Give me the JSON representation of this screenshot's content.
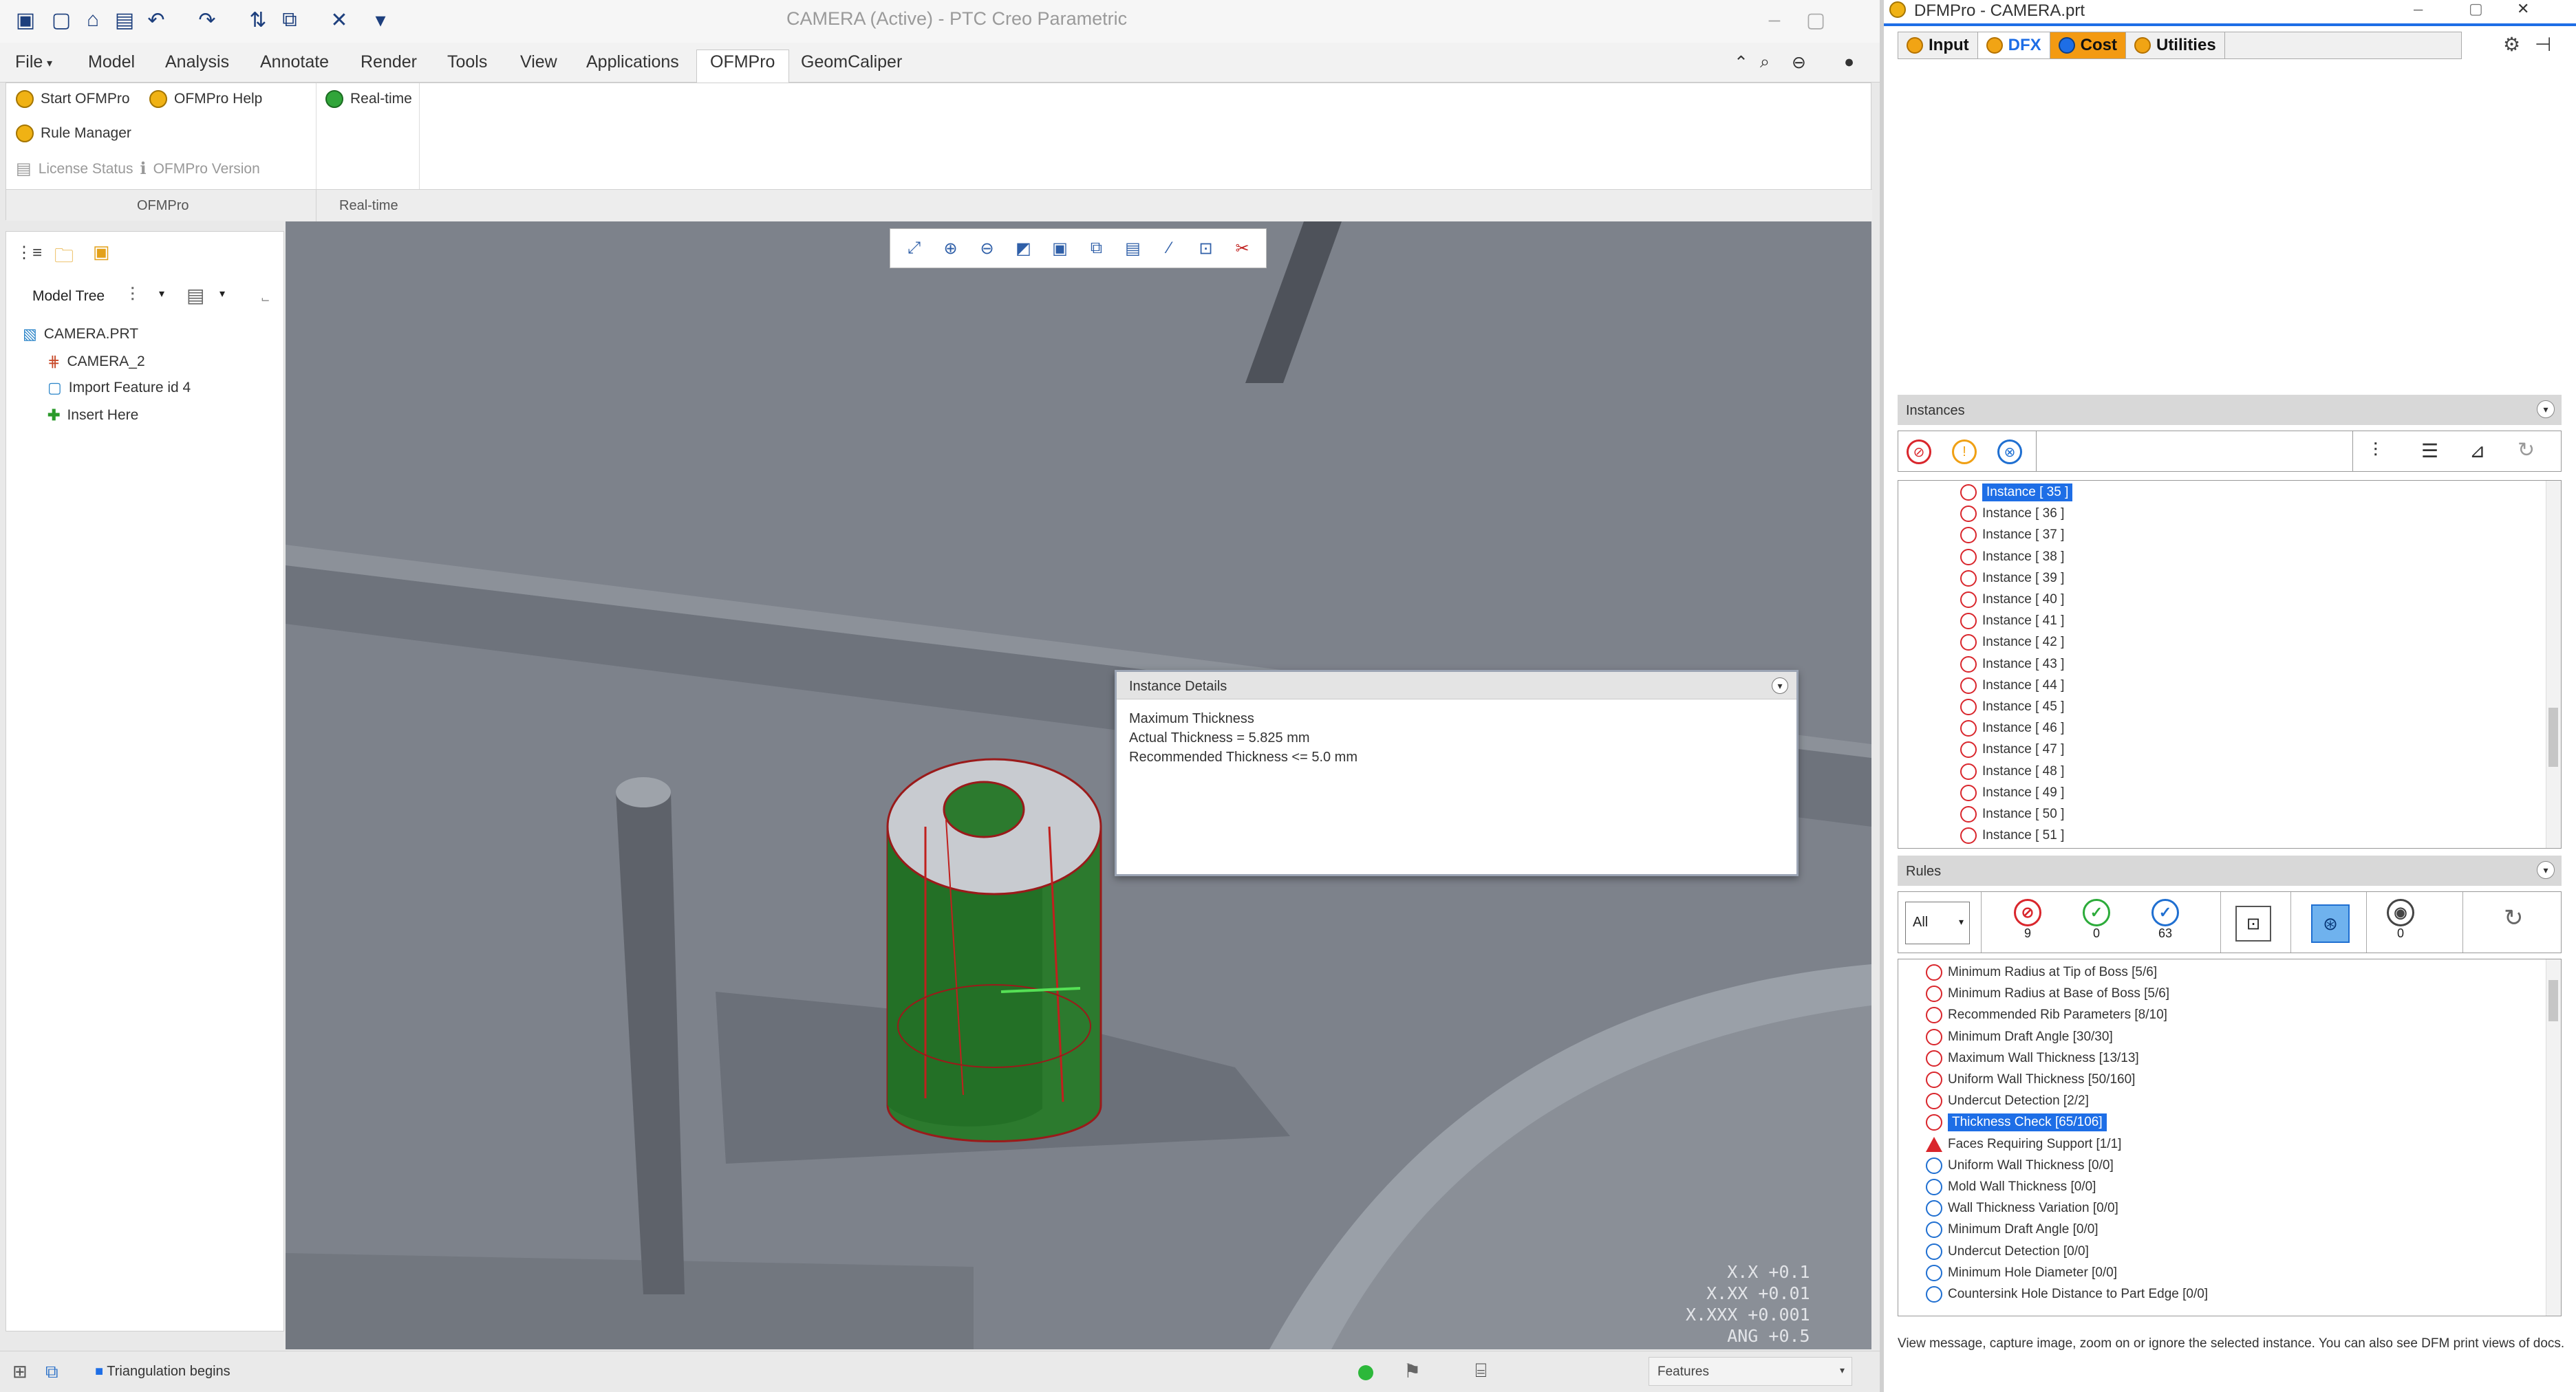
{
  "window": {
    "title": "CAMERA (Active) - PTC Creo Parametric"
  },
  "menu": [
    "File",
    "Model",
    "Analysis",
    "Annotate",
    "Render",
    "Tools",
    "View",
    "Applications",
    "OFMPro",
    "GeomCaliper"
  ],
  "ribbon": {
    "start_ofmpro": "Start OFMPro",
    "ofmpro_help": "OFMPro Help",
    "real_time": "Real-time",
    "rule_manager": "Rule Manager",
    "license_status": "License Status",
    "ofmpro_version": "OFMPro Version",
    "group_ofmpro": "OFMPro",
    "group_realtime": "Real-time"
  },
  "tree": {
    "label": "Model Tree",
    "items": [
      "CAMERA.PRT",
      "CAMERA_2",
      "Import Feature id 4",
      "Insert Here"
    ]
  },
  "popup": {
    "title": "Instance Details",
    "lines": [
      "Maximum Thickness",
      "Actual Thickness = 5.825 mm",
      "Recommended Thickness <= 5.0 mm"
    ]
  },
  "coords": [
    "X.X +0.1",
    "X.XX +0.01",
    "X.XXX +0.001",
    "ANG +0.5"
  ],
  "status": {
    "message": "Triangulation begins",
    "filter": "Features"
  },
  "panel": {
    "title": "DFMPro - CAMERA.prt",
    "tabs": [
      "Input",
      "DFX",
      "Cost",
      "Utilities"
    ],
    "instances_label": "Instances",
    "instances": [
      "Instance [ 35 ]",
      "Instance [ 36 ]",
      "Instance [ 37 ]",
      "Instance [ 38 ]",
      "Instance [ 39 ]",
      "Instance [ 40 ]",
      "Instance [ 41 ]",
      "Instance [ 42 ]",
      "Instance [ 43 ]",
      "Instance [ 44 ]",
      "Instance [ 45 ]",
      "Instance [ 46 ]",
      "Instance [ 47 ]",
      "Instance [ 48 ]",
      "Instance [ 49 ]",
      "Instance [ 50 ]",
      "Instance [ 51 ]"
    ],
    "rules_label": "Rules",
    "filter_value": "All",
    "count_fail": "9",
    "count_pass": "0",
    "count_check": "63",
    "count_other": "0",
    "rules": [
      {
        "text": "Minimum Radius at Tip of Boss [5/6]",
        "status": "fail"
      },
      {
        "text": "Minimum Radius at Base of Boss [5/6]",
        "status": "fail"
      },
      {
        "text": "Recommended Rib Parameters [8/10]",
        "status": "fail"
      },
      {
        "text": "Minimum Draft Angle [30/30]",
        "status": "fail"
      },
      {
        "text": "Maximum Wall Thickness [13/13]",
        "status": "fail"
      },
      {
        "text": "Uniform Wall Thickness [50/160]",
        "status": "fail"
      },
      {
        "text": "Undercut Detection [2/2]",
        "status": "fail"
      },
      {
        "text": "Thickness Check [65/106]",
        "status": "fail",
        "selected": true
      },
      {
        "text": "Faces Requiring Support [1/1]",
        "status": "warn"
      },
      {
        "text": "Uniform Wall Thickness [0/0]",
        "status": "pass"
      },
      {
        "text": "Mold Wall Thickness [0/0]",
        "status": "pass"
      },
      {
        "text": "Wall Thickness Variation [0/0]",
        "status": "pass"
      },
      {
        "text": "Minimum Draft Angle [0/0]",
        "status": "pass"
      },
      {
        "text": "Undercut Detection [0/0]",
        "status": "pass"
      },
      {
        "text": "Minimum Hole Diameter [0/0]",
        "status": "pass"
      },
      {
        "text": "Countersink Hole Distance to Part Edge [0/0]",
        "status": "pass"
      }
    ],
    "hint": "View message, capture image, zoom on or ignore the selected instance. You can also see DFM print views of docs."
  },
  "colors": {
    "accent": "#1e6ee6",
    "fail": "#d9262c",
    "pass": "#1f6fd1",
    "feature": "#2c7a2e",
    "model": "#7b8089"
  }
}
